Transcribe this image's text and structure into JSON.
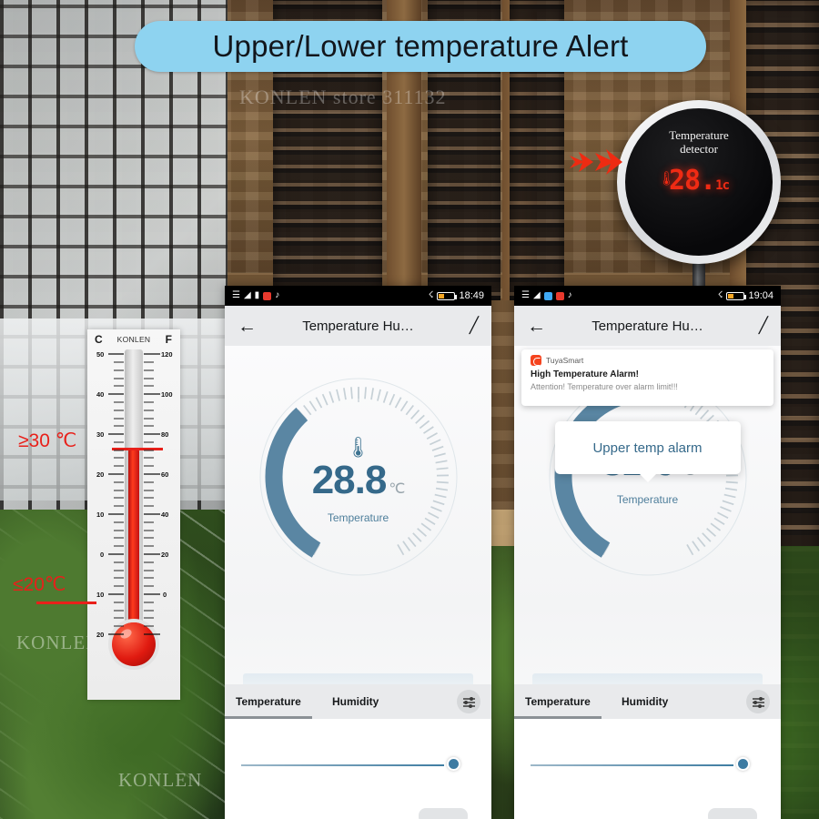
{
  "banner": {
    "title": "Upper/Lower temperature Alert"
  },
  "watermarks": {
    "top": "KONLEN store 311132",
    "left": "KONLEN",
    "bottom": "KONLEN"
  },
  "device": {
    "title_line1": "Temperature",
    "title_line2": "detector",
    "reading": "28.",
    "reading_decimal": "1",
    "unit": "c",
    "thermo_icon": "thermometer-icon"
  },
  "thermometer": {
    "brand": "KONLEN",
    "scale_c_label": "C",
    "scale_f_label": "F",
    "celsius_ticks": [
      "50",
      "40",
      "30",
      "20",
      "10",
      "0",
      "10",
      "20"
    ],
    "fahrenheit_ticks": [
      "120",
      "100",
      "80",
      "60",
      "40",
      "20",
      "0"
    ],
    "upper_label": "≥30 ℃",
    "lower_label": "≤20℃"
  },
  "phone_left": {
    "statusbar": {
      "time": "18:49",
      "signal": "4G",
      "wifi": "wifi-icon",
      "bluetooth": "bluetooth-icon"
    },
    "appbar": {
      "back": "←",
      "title": "Temperature Hu…",
      "edit": "edit-icon"
    },
    "gauge": {
      "value": "28.8",
      "unit": "℃",
      "label": "Temperature",
      "arc_percent": 36,
      "accent": "#5a86a3"
    },
    "tabs": [
      {
        "label": "Temperature",
        "active": true
      },
      {
        "label": "Humidity",
        "active": false
      }
    ],
    "settings_icon": "sliders-icon",
    "slider": {
      "value_percent": 88
    }
  },
  "phone_right": {
    "statusbar": {
      "time": "19:04",
      "signal": "4G",
      "wifi": "wifi-icon",
      "bluetooth": "bluetooth-icon"
    },
    "appbar": {
      "back": "←",
      "title": "Temperature Hu…",
      "edit": "edit-icon"
    },
    "notification": {
      "app": "TuyaSmart",
      "title": "High Temperature Alarm!",
      "body": "Attention! Temperature over alarm limit!!!"
    },
    "tooltip": {
      "text": "Upper temp alarm"
    },
    "gauge": {
      "value": "32.0",
      "unit": "℃",
      "label": "Temperature",
      "arc_percent": 44,
      "accent": "#5a86a3"
    },
    "tabs": [
      {
        "label": "Temperature",
        "active": true
      },
      {
        "label": "Humidity",
        "active": false
      }
    ],
    "settings_icon": "sliders-icon",
    "slider": {
      "value_percent": 88
    }
  },
  "colors": {
    "banner_bg": "#8ed3f0",
    "accent_blue": "#35698a",
    "alert_red": "#e8201a",
    "led_red": "#ef2b14"
  }
}
